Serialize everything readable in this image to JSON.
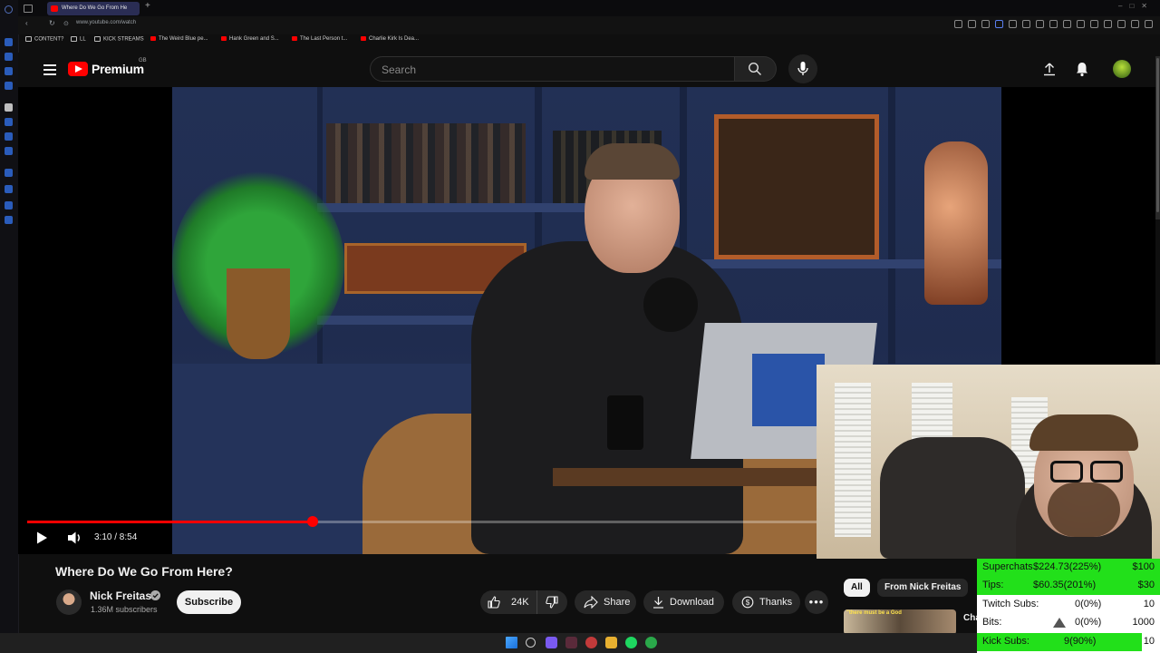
{
  "browser": {
    "tab_title": "Where Do We Go From He",
    "url": "www.youtube.com/watch",
    "bookmarks": [
      "CONTENT?",
      "LL",
      "KICK STREAMS",
      "The Weird Blue pe...",
      "Hank Green and S...",
      "The Last Person t...",
      "Charlie Kirk Is Dea..."
    ]
  },
  "header": {
    "logo_text": "Premium",
    "region": "GB",
    "search_placeholder": "Search"
  },
  "player": {
    "time": "3:10 / 8:54",
    "progress": 0.36
  },
  "video": {
    "title": "Where Do We Go From Here?",
    "channel_name": "Nick Freitas",
    "subscribers": "1.36M subscribers",
    "subscribe_label": "Subscribe",
    "like_count": "24K",
    "share_label": "Share",
    "download_label": "Download",
    "thanks_label": "Thanks"
  },
  "related": {
    "chips": [
      "All",
      "From Nick Freitas"
    ],
    "thumb_text": "\"there must be a God",
    "title_fragment": "Cha"
  },
  "stats": {
    "superchats": {
      "label": "Superchats",
      "value": "$224.73(225%)",
      "total": "$100"
    },
    "tips": {
      "label": "Tips:",
      "value": "$60.35(201%)",
      "total": "$30"
    },
    "twitch_subs": {
      "label": "Twitch Subs:",
      "value": "0(0%)",
      "total": "10"
    },
    "bits": {
      "label": "Bits:",
      "value": "0(0%)",
      "total": "1000"
    },
    "kick_subs": {
      "label": "Kick Subs:",
      "value": "9(90%)",
      "total": "10"
    }
  },
  "colors": {
    "accent": "#ff0000",
    "goal_green": "#22e01a",
    "background": "#0f0f0f"
  }
}
